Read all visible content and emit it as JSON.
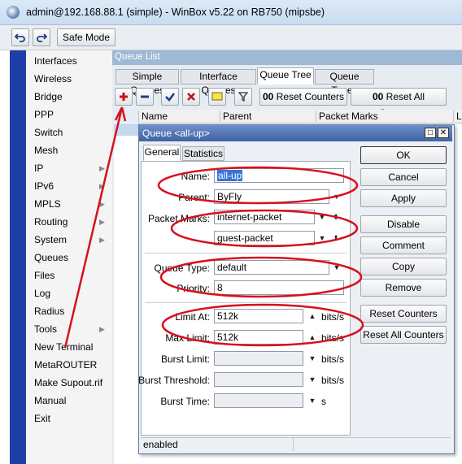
{
  "window": {
    "title": "admin@192.168.88.1 (simple) - WinBox v5.22 on RB750 (mipsbe)"
  },
  "toolbar": {
    "undo_icon": "undo-icon",
    "redo_icon": "redo-icon",
    "safe_mode_label": "Safe Mode"
  },
  "sidebar": {
    "items": [
      {
        "label": "Interfaces",
        "submenu": false
      },
      {
        "label": "Wireless",
        "submenu": false
      },
      {
        "label": "Bridge",
        "submenu": false
      },
      {
        "label": "PPP",
        "submenu": false
      },
      {
        "label": "Switch",
        "submenu": false
      },
      {
        "label": "Mesh",
        "submenu": false
      },
      {
        "label": "IP",
        "submenu": true
      },
      {
        "label": "IPv6",
        "submenu": true
      },
      {
        "label": "MPLS",
        "submenu": true
      },
      {
        "label": "Routing",
        "submenu": true
      },
      {
        "label": "System",
        "submenu": true
      },
      {
        "label": "Queues",
        "submenu": false
      },
      {
        "label": "Files",
        "submenu": false
      },
      {
        "label": "Log",
        "submenu": false
      },
      {
        "label": "Radius",
        "submenu": false
      },
      {
        "label": "Tools",
        "submenu": true
      },
      {
        "label": "New Terminal",
        "submenu": false
      },
      {
        "label": "MetaROUTER",
        "submenu": false
      },
      {
        "label": "Make Supout.rif",
        "submenu": false
      },
      {
        "label": "Manual",
        "submenu": false
      },
      {
        "label": "Exit",
        "submenu": false
      }
    ]
  },
  "queue_list": {
    "title": "Queue List",
    "tabs": [
      "Simple Queues",
      "Interface Queues",
      "Queue Tree",
      "Queue Types"
    ],
    "active_tab": "Queue Tree",
    "reset_counters_label": "Reset Counters",
    "reset_all_counters_label": "Reset All Counters",
    "counter_icon": "00",
    "columns": [
      "Name",
      "Parent",
      "Packet Marks",
      "L"
    ]
  },
  "dialog": {
    "title": "Queue <all-up>",
    "tabs": [
      "General",
      "Statistics"
    ],
    "active_tab": "General",
    "labels": {
      "name": "Name:",
      "parent": "Parent:",
      "packet_marks": "Packet Marks:",
      "queue_type": "Queue Type:",
      "priority": "Priority:",
      "limit_at": "Limit At:",
      "max_limit": "Max Limit:",
      "burst_limit": "Burst Limit:",
      "burst_threshold": "Burst Threshold:",
      "burst_time": "Burst Time:"
    },
    "values": {
      "name": "all-up",
      "parent": "ByFly",
      "packet_mark_1": "internet-packet",
      "packet_mark_2": "guest-packet",
      "queue_type": "default",
      "priority": "8",
      "limit_at": "512k",
      "max_limit": "512k",
      "burst_limit": "",
      "burst_threshold": "",
      "burst_time": ""
    },
    "units": {
      "bits": "bits/s",
      "seconds": "s"
    },
    "buttons": [
      "OK",
      "Cancel",
      "Apply",
      "Disable",
      "Comment",
      "Copy",
      "Remove",
      "Reset Counters",
      "Reset All Counters"
    ],
    "status": "enabled"
  },
  "annotations": {
    "highlight_color": "#d8101e"
  }
}
